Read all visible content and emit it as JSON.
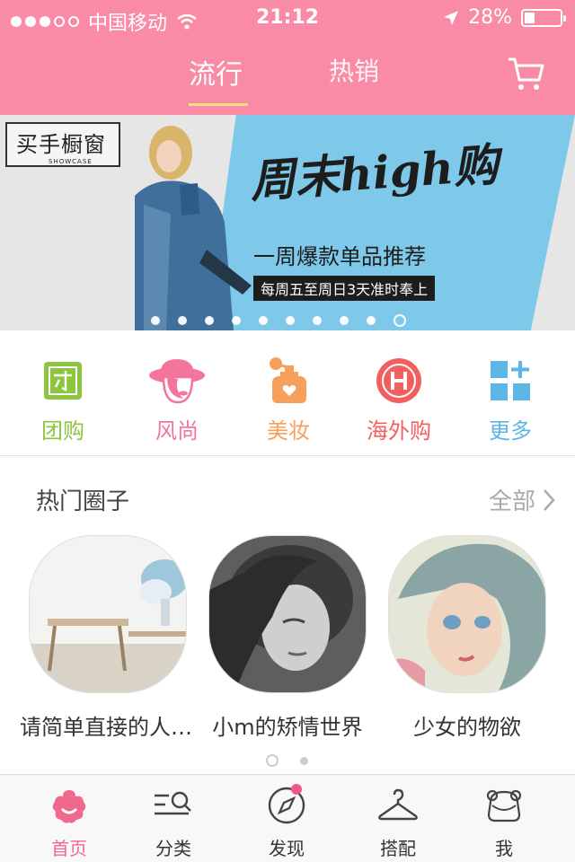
{
  "status": {
    "carrier": "中国移动",
    "time": "21:12",
    "battery": "28%",
    "battery_level": 0.28
  },
  "header": {
    "tabs": [
      "流行",
      "热销"
    ],
    "active_tab": 0
  },
  "banner": {
    "logo": "买手橱窗",
    "logo_sub": "SHOWCASE",
    "headline": "周末high购",
    "subline": "一周爆款单品推荐",
    "tagline": "每周五至周日3天准时奉上",
    "page_count": 10,
    "active_page": 9
  },
  "categories": [
    {
      "label": "团购",
      "icon": "group-buy-icon",
      "color": "#8cc63f"
    },
    {
      "label": "风尚",
      "icon": "fashion-hat-icon",
      "color": "#f4759b"
    },
    {
      "label": "美妆",
      "icon": "perfume-icon",
      "color": "#f7a05c"
    },
    {
      "label": "海外购",
      "icon": "overseas-h-icon",
      "color": "#f35f5f"
    },
    {
      "label": "更多",
      "icon": "more-grid-icon",
      "color": "#5bb6e6"
    }
  ],
  "hot": {
    "title": "热门圈子",
    "all": "全部",
    "items": [
      {
        "name": "请简单直接的人…"
      },
      {
        "name": "小m的矫情世界"
      },
      {
        "name": "少女的物欲"
      }
    ]
  },
  "tabbar": {
    "items": [
      "首页",
      "分类",
      "发现",
      "搭配",
      "我"
    ],
    "active": 0
  },
  "colors": {
    "brand": "#f98ba7",
    "accent": "#f0688c"
  }
}
